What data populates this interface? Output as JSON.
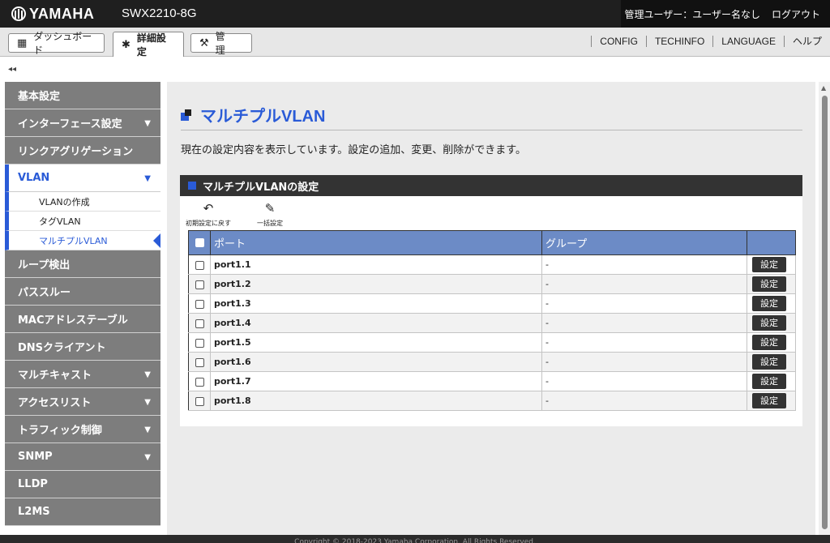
{
  "header": {
    "brand": "YAMAHA",
    "model": "SWX2210-8G",
    "user_label": "管理ユーザー：ユーザー名なし",
    "logout": "ログアウト"
  },
  "tabs": [
    {
      "label": "ダッシュボード",
      "icon": "dashboard-icon",
      "glyph": "▦"
    },
    {
      "label": "詳細設定",
      "icon": "gear-icon",
      "glyph": "✱"
    },
    {
      "label": "管　理",
      "icon": "wrench-icon",
      "glyph": "🔧"
    }
  ],
  "top_links": [
    "CONFIG",
    "TECHINFO",
    "LANGUAGE",
    "ヘルプ"
  ],
  "collapse_glyph": "◂◂",
  "sidebar": {
    "items": [
      {
        "label": "基本設定"
      },
      {
        "label": "インターフェース設定",
        "caret": "▼"
      },
      {
        "label": "リンクアグリゲーション"
      },
      {
        "label": "VLAN",
        "caret": "▼"
      },
      {
        "label": "ループ検出"
      },
      {
        "label": "パススルー"
      },
      {
        "label": "MACアドレステーブル"
      },
      {
        "label": "DNSクライアント"
      },
      {
        "label": "マルチキャスト",
        "caret": "▼"
      },
      {
        "label": "アクセスリスト",
        "caret": "▼"
      },
      {
        "label": "トラフィック制御",
        "caret": "▼"
      },
      {
        "label": "SNMP",
        "caret": "▼"
      },
      {
        "label": "LLDP"
      },
      {
        "label": "L2MS"
      }
    ],
    "vlan_sub": [
      "VLANの作成",
      "タグVLAN",
      "マルチプルVLAN"
    ]
  },
  "page": {
    "title": "マルチプルVLAN",
    "description": "現在の設定内容を表示しています。設定の追加、変更、削除ができます。"
  },
  "panel": {
    "title": "マルチプルVLANの設定",
    "tools": [
      {
        "label": "初期設定に戻す",
        "icon": "reset-icon",
        "glyph": "↶"
      },
      {
        "label": "一括設定",
        "icon": "bulk-edit-icon",
        "glyph": "✎"
      }
    ],
    "columns": {
      "port": "ポート",
      "group": "グループ"
    },
    "set_label": "設定",
    "rows": [
      {
        "port": "port1.1",
        "group": "-"
      },
      {
        "port": "port1.2",
        "group": "-"
      },
      {
        "port": "port1.3",
        "group": "-"
      },
      {
        "port": "port1.4",
        "group": "-"
      },
      {
        "port": "port1.5",
        "group": "-"
      },
      {
        "port": "port1.6",
        "group": "-"
      },
      {
        "port": "port1.7",
        "group": "-"
      },
      {
        "port": "port1.8",
        "group": "-"
      }
    ]
  },
  "footer": "Copyright © 2018-2023 Yamaha Corporation. All Rights Reserved."
}
